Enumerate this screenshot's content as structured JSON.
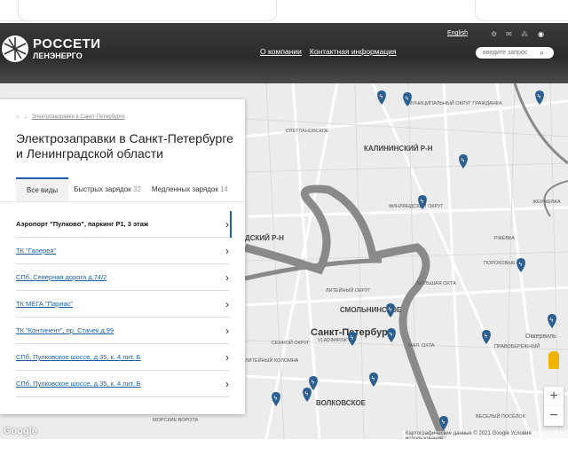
{
  "header": {
    "logo_title": "РОССЕТИ",
    "logo_sub": "ЛЕНЭНЕРГО",
    "nav": [
      "О компании",
      "Контактная информация"
    ],
    "lang": "English",
    "search_placeholder": "введите запрос"
  },
  "panel": {
    "breadcrumb": "Электрозаправки в Санкт-Петербурге",
    "title": "Электрозаправки в Санкт-Петербурге и Ленинградской области",
    "tabs": [
      {
        "label": "Все виды",
        "count": ""
      },
      {
        "label": "Быстрых зарядок",
        "count": "32"
      },
      {
        "label": "Медленных зарядок",
        "count": "14"
      }
    ],
    "items": [
      "Аэропорт \"Пулково\", паркинг Р1, 3 этаж",
      "ТК \"Галерея\"",
      "СПб, Северная дорога д.74/2",
      "ТК МЕГА \"Парнас\"",
      "ТК \"Континент\", пр. Стачек д.99",
      "СПб, Пулковское шоссе, д.35, к. 4 лит. Б",
      "СПб, Пулковское шоссе, д.35, к. 4 лит. Б"
    ]
  },
  "map": {
    "labels": [
      "МУНИЦИПАЛЬНЫЙ ОКРУГ ГРАЖДАНКА",
      "СВЕТЛАНОВСКОЕ",
      "КАЛИНИНСКИЙ Р-Н",
      "ФИНЛЯНДСКИЙ ОКРУГ",
      "ЖЕРЖЕВКА",
      "РЖЕВКА",
      "ПОРОХОВЫЕ",
      "ДСКИЙ Р-Н",
      "БОЛЬШАЯ ОХТА",
      "ЛИТЕЙНЫЙ ОКРУГ",
      "СМОЛЬНИНСКОЕ",
      "Санкт-Петербург",
      "VLADIMIRSKY",
      "СЕННОЙ ОКРУГ",
      "МАЛ. ОХТА",
      "ПРАВОБЕРЕЖНЫЙ",
      "Оккервиль",
      "ВОЛКОВСКОЕ",
      "ЛИТЕЙНЫЙ КОЛОМНА",
      "МОРСКИЕ ВОРОТА",
      "ВЕСЕЛЫЙ ПОСЁЛОК"
    ],
    "google": "Google",
    "attribution": "Картографические данные © 2021 Google   Условия использования",
    "zoom_in": "+",
    "zoom_out": "−"
  },
  "colors": {
    "accent": "#1b5fa8",
    "marker": "#2b5f8f",
    "river": "#808080",
    "header": "#333333"
  }
}
